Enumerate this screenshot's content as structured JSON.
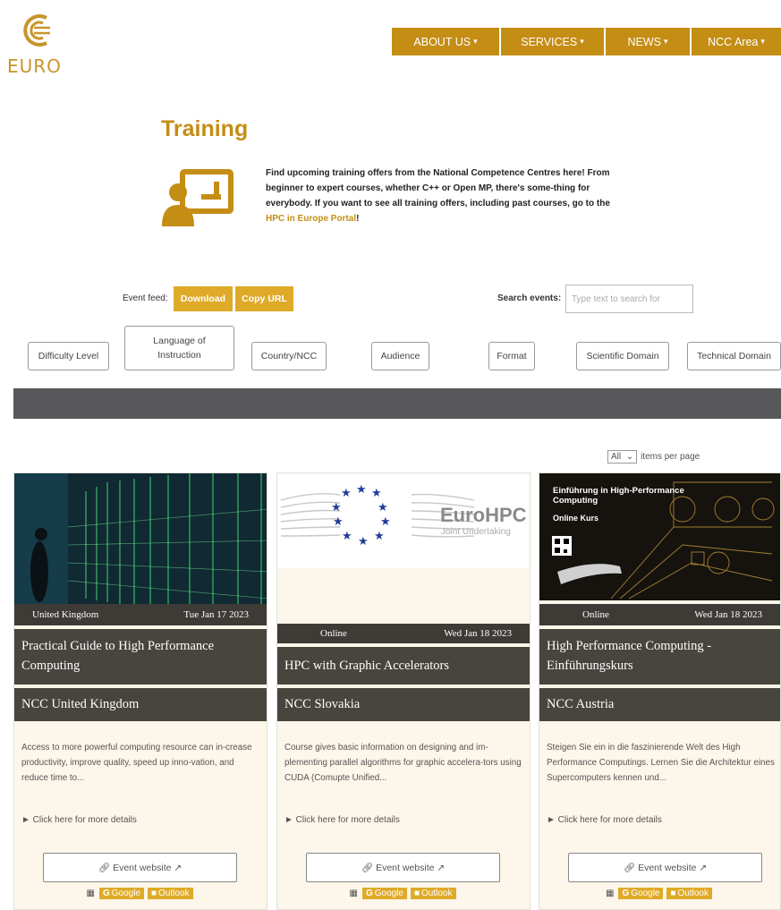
{
  "logo": {
    "text": "EURO"
  },
  "nav": [
    {
      "label": "ABOUT US",
      "caret": "▾"
    },
    {
      "label": "SERVICES",
      "caret": "▾"
    },
    {
      "label": "NEWS",
      "caret": "▾"
    },
    {
      "label": "NCC Area",
      "caret": "▾"
    }
  ],
  "page": {
    "title": "Training",
    "intro_pre": "Find upcoming training offers from the National Competence Centres here! From beginner to expert courses, whether C++ or Open MP, there's some-thing for everybody. If you want to see all training offers, including past courses, go to the ",
    "intro_link": "HPC in Europe Portal",
    "intro_post": "!"
  },
  "feed": {
    "label": "Event feed:",
    "download": "Download",
    "copy_url": "Copy URL",
    "search_label": "Search events:",
    "search_placeholder": "Type text to search for"
  },
  "filters": [
    "Difficulty Level",
    "Language of Instruction",
    "Country/NCC",
    "Audience",
    "Format",
    "Scientific Domain",
    "Technical Domain"
  ],
  "pagination": {
    "selected": "All",
    "arrow": "⌄",
    "suffix": "items per page"
  },
  "card_common": {
    "details": "► Click here for more details",
    "event_website": "Event website",
    "google": "Google",
    "outlook": "Outlook"
  },
  "cards": [
    {
      "location": "United Kingdom",
      "date": "Tue Jan 17 2023",
      "title": "Practical Guide to High Performance Computing",
      "ncc": "NCC United Kingdom",
      "description": "Access to more powerful computing resource can in-crease productivity, improve quality, speed up inno-vation, and reduce time to..."
    },
    {
      "location": "Online",
      "date": "Wed Jan 18 2023",
      "title": "HPC with Graphic Accelerators",
      "ncc": "NCC Slovakia",
      "description": "Course gives basic information on designing and im-plementing parallel algorithms for graphic accelera-tors using CUDA (Comupte Unified...",
      "image_brand": "EuroHPC",
      "image_brand_sub": "Joint Undertaking"
    },
    {
      "location": "Online",
      "date": "Wed Jan 18 2023",
      "title": "High Performance Computing - Einführungskurs",
      "ncc": "NCC Austria",
      "description": "Steigen Sie ein in die faszinierende Welt des High Performance Computings. Lernen Sie die Architektur eines Supercomputers kennen und...",
      "image_heading": "Einführung in High-Performance Computing",
      "image_sub": "Online Kurs"
    }
  ]
}
